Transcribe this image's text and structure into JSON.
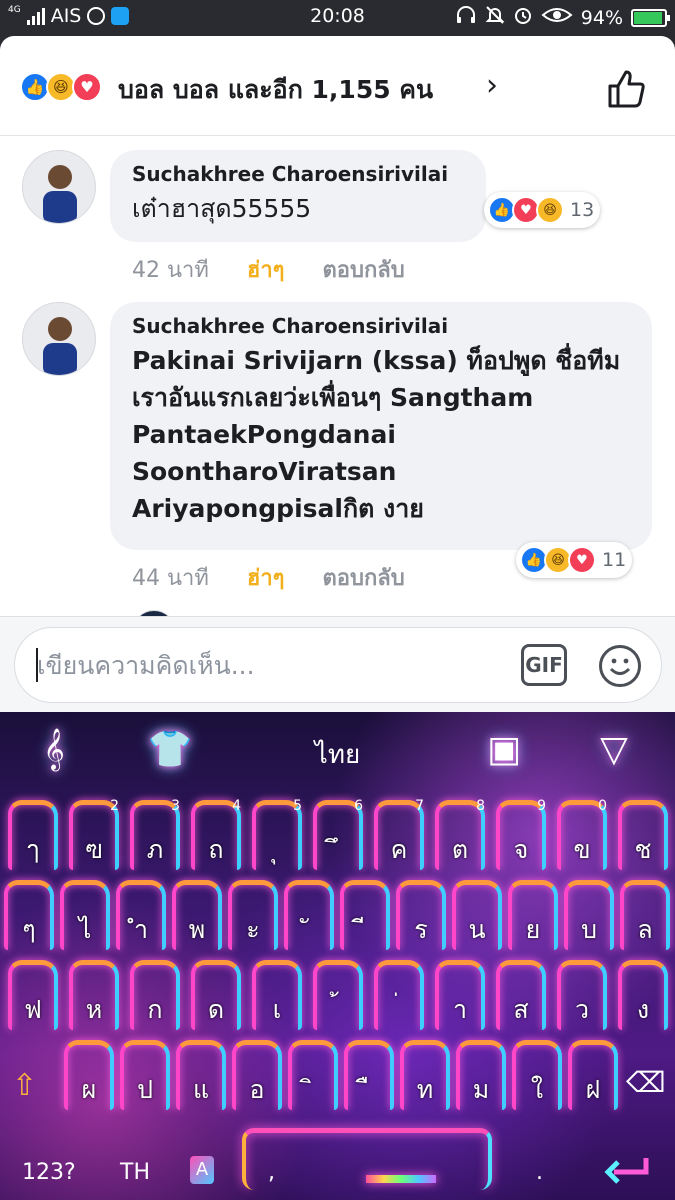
{
  "status_bar": {
    "network": "4G",
    "carrier": "AIS",
    "time": "20:08",
    "battery_percent": "94%",
    "battery_level": 0.94,
    "icons": [
      "headset-icon",
      "bell-off-icon",
      "alarm-icon",
      "eye-icon",
      "battery-charging-icon"
    ]
  },
  "reactions_summary": {
    "icons": [
      "like",
      "haha",
      "love"
    ],
    "text": "บอล บอล และอีก 1,155 คน"
  },
  "comments": [
    {
      "author": "Suchakhree Charoensirivilai",
      "text": "เต๋าฮาสุด55555",
      "bold_text": false,
      "time": "42 นาที",
      "reaction_action": "ฮ่าๆ",
      "reply_label": "ตอบกลับ",
      "reactions": [
        "like",
        "love",
        "haha"
      ],
      "reaction_count": "13"
    },
    {
      "author": "Suchakhree Charoensirivilai",
      "text_lines": [
        "Pakinai Srivijarn (kssa) ท็อปพูด ชื่อทีม",
        "เราอันแรกเลยว่ะเพื่อนๆ Sangtham",
        "PantaekPongdanai",
        "SoontharoViratsan",
        "Ariyapongpisalกิต งาย"
      ],
      "bold_text": true,
      "time": "44 นาที",
      "reaction_action": "ฮ่าๆ",
      "reply_label": "ตอบกลับ",
      "reactions": [
        "like",
        "haha",
        "love"
      ],
      "reaction_count": "11"
    }
  ],
  "composer": {
    "placeholder": "เขียนความคิดเห็น...",
    "gif_label": "GIF"
  },
  "keyboard": {
    "language": "ไทย",
    "rows": [
      {
        "keys": [
          "ๅ",
          "ฃ",
          "ภ",
          "ถ",
          "ุ",
          "ึ",
          "ค",
          "ต",
          "จ",
          "ข",
          "ช"
        ],
        "hints": [
          "",
          "2",
          "3",
          "4",
          "5",
          "6",
          "7",
          "8",
          "9",
          "0",
          ""
        ]
      },
      {
        "keys": [
          "ๆ",
          "ไ",
          "ำ",
          "พ",
          "ะ",
          "ั",
          "ี",
          "ร",
          "น",
          "ย",
          "บ",
          "ล"
        ]
      },
      {
        "keys": [
          "ฟ",
          "ห",
          "ก",
          "ด",
          "เ",
          "้",
          "่",
          "า",
          "ส",
          "ว",
          "ง"
        ]
      },
      {
        "keys": [
          "ผ",
          "ป",
          "แ",
          "อ",
          "ิ",
          "ื",
          "ท",
          "ม",
          "ใ",
          "ฝ"
        ]
      }
    ],
    "numbers_label": "123?",
    "lang_switch_label": "TH",
    "comma_label": ",",
    "period_label": "."
  },
  "colors": {
    "facebook_blue": "#1877f2",
    "haha_yellow": "#f7b928",
    "love_red": "#f33e58",
    "haha_action": "#f2b01e"
  }
}
